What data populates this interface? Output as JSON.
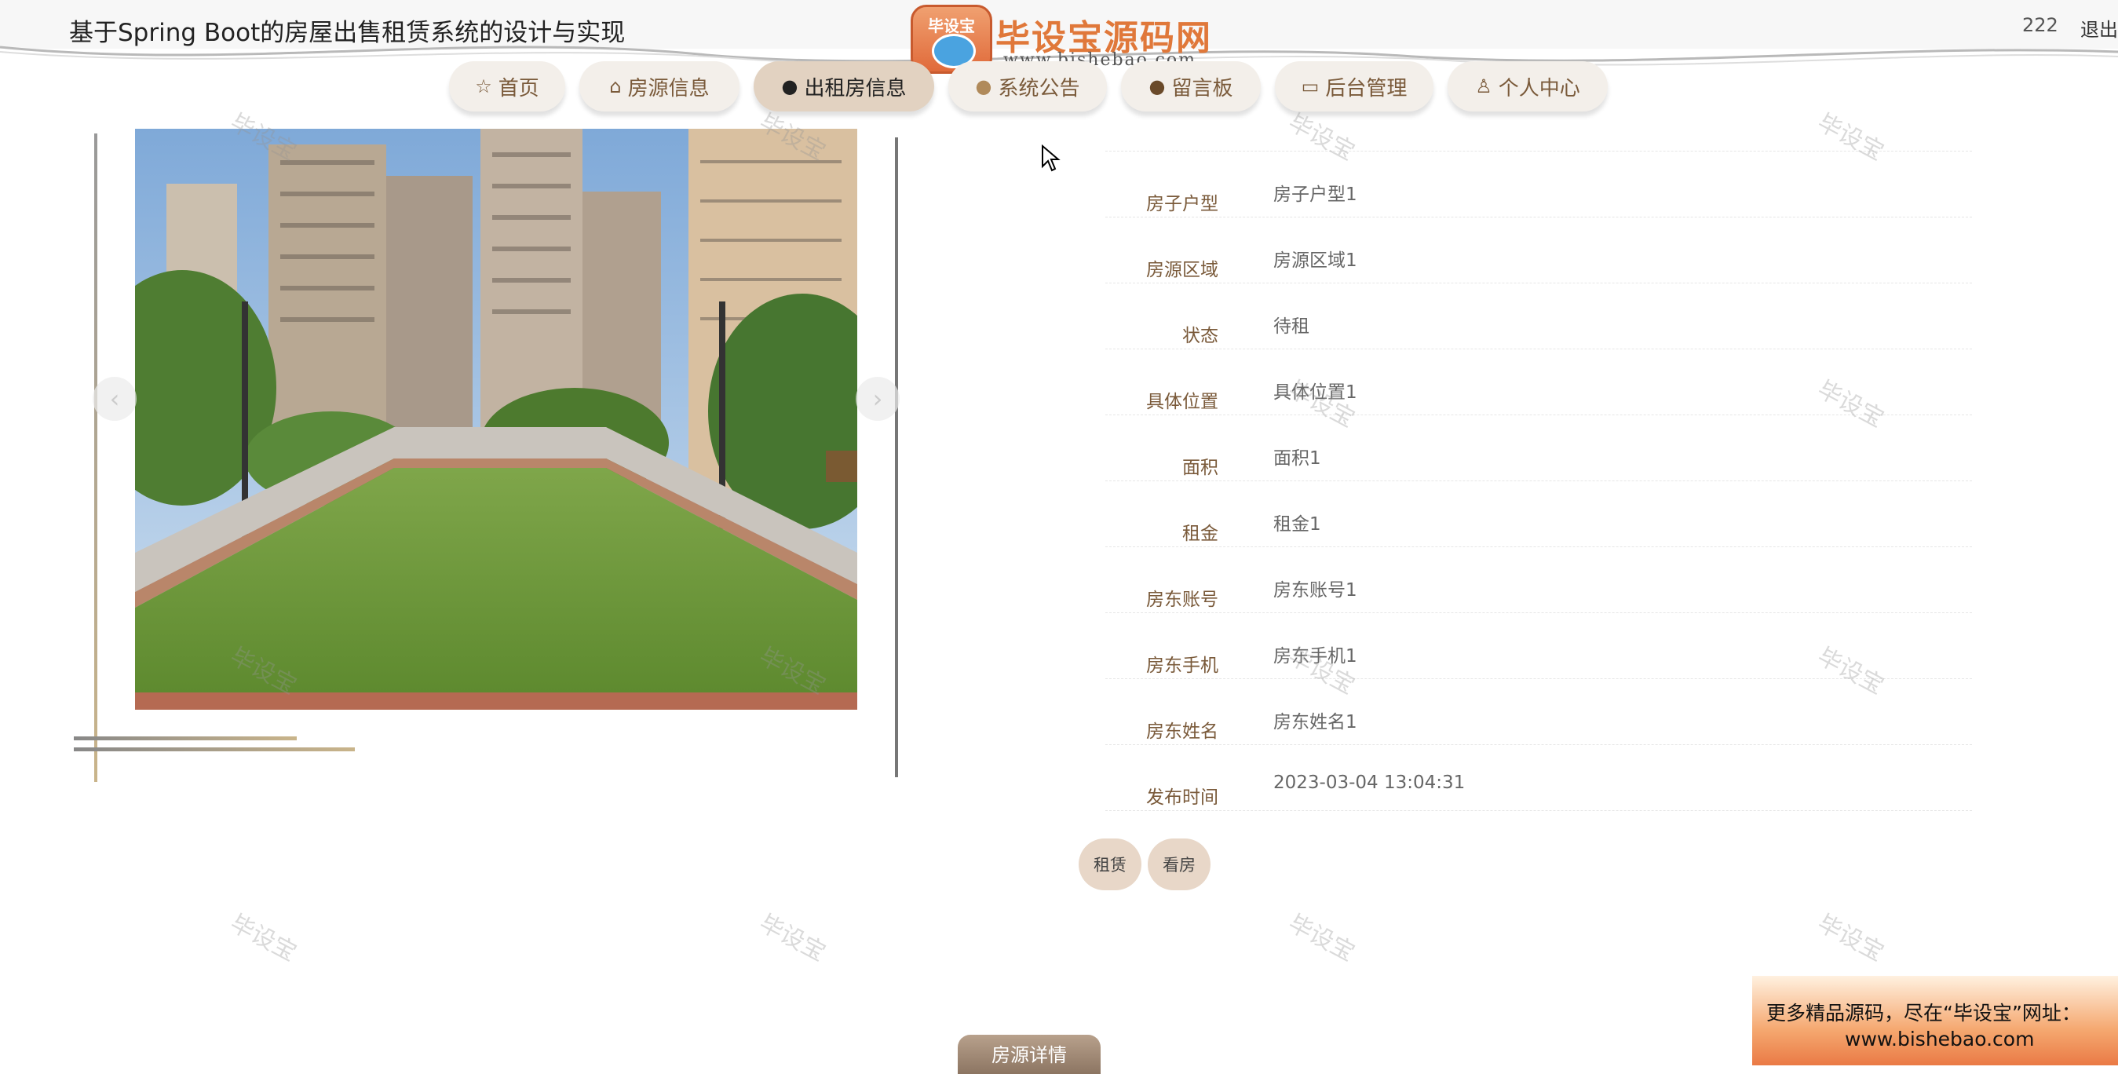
{
  "header": {
    "site_title": "基于Spring Boot的房屋出售租赁系统的设计与实现",
    "user_name": "222",
    "logout": "退出",
    "logo": {
      "badge": "毕设宝",
      "name": "毕设宝源码网",
      "url": "www.bishebao.com"
    }
  },
  "nav": {
    "items": [
      {
        "icon": "star-icon",
        "label": "首页"
      },
      {
        "icon": "house-icon",
        "label": "房源信息"
      },
      {
        "icon": "alert-circle-icon",
        "label": "出租房信息",
        "active": true
      },
      {
        "icon": "question-circle-icon",
        "label": "系统公告"
      },
      {
        "icon": "info-circle-icon",
        "label": "留言板"
      },
      {
        "icon": "briefcase-icon",
        "label": "后台管理"
      },
      {
        "icon": "user-icon",
        "label": "个人中心"
      }
    ]
  },
  "gallery": {
    "prev": "‹",
    "next": "›"
  },
  "details": {
    "rows": [
      {
        "label": "房子户型",
        "value": "房子户型1"
      },
      {
        "label": "房源区域",
        "value": "房源区域1"
      },
      {
        "label": "状态",
        "value": "待租"
      },
      {
        "label": "具体位置",
        "value": "具体位置1"
      },
      {
        "label": "面积",
        "value": "面积1"
      },
      {
        "label": "租金",
        "value": "租金1"
      },
      {
        "label": "房东账号",
        "value": "房东账号1"
      },
      {
        "label": "房东手机",
        "value": "房东手机1"
      },
      {
        "label": "房东姓名",
        "value": "房东姓名1"
      },
      {
        "label": "发布时间",
        "value": "2023-03-04 13:04:31"
      }
    ]
  },
  "actions": {
    "rent": "租赁",
    "view": "看房"
  },
  "watermark": "毕设宝",
  "promo": {
    "line1": "更多精品源码，尽在“毕设宝”网址：",
    "line2": "www.bishebao.com"
  },
  "bottom_tab": "房源详情",
  "colors": {
    "accent": "#7a5a3a",
    "button": "#e8d7c8",
    "nav_active": "#e2d2c1"
  }
}
